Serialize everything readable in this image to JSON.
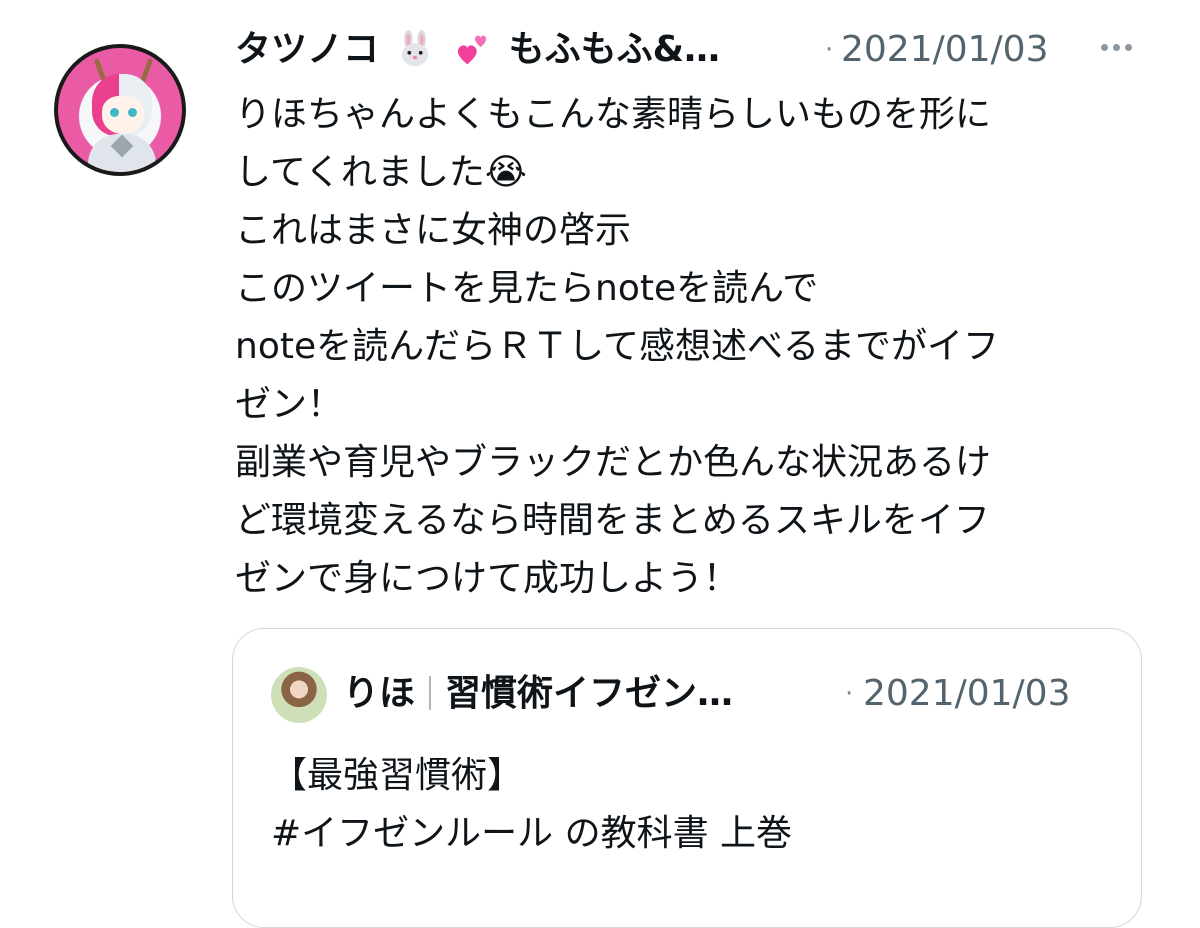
{
  "tweet": {
    "author_name": "タツノコ",
    "author_name_suffix": "もふもふ&…",
    "emoji_icons": [
      "rabbit-face-icon",
      "two-hearts-icon"
    ],
    "separator": "·",
    "date": "2021/01/03",
    "lines": [
      "りほちゃんよくもこんな素晴らしいものを形に",
      "してくれました😭",
      "これはまさに女神の啓示",
      "このツイートを見たらnoteを読んで",
      "noteを読んだらＲＴして感想述べるまでがイフ",
      "ゼン！",
      "副業や育児やブラックだとか色んな状況あるけ",
      "ど環境変えるなら時間をまとめるスキルをイフ",
      "ゼンで身につけて成功しよう！"
    ]
  },
  "quoted_tweet": {
    "author_name": "りほ",
    "author_name_suffix": "習慣術イフゼン…",
    "separator": "·",
    "date": "2021/01/03",
    "lines": [
      "【最強習慣術】",
      "#イフゼンルール の教科書 上巻"
    ]
  }
}
